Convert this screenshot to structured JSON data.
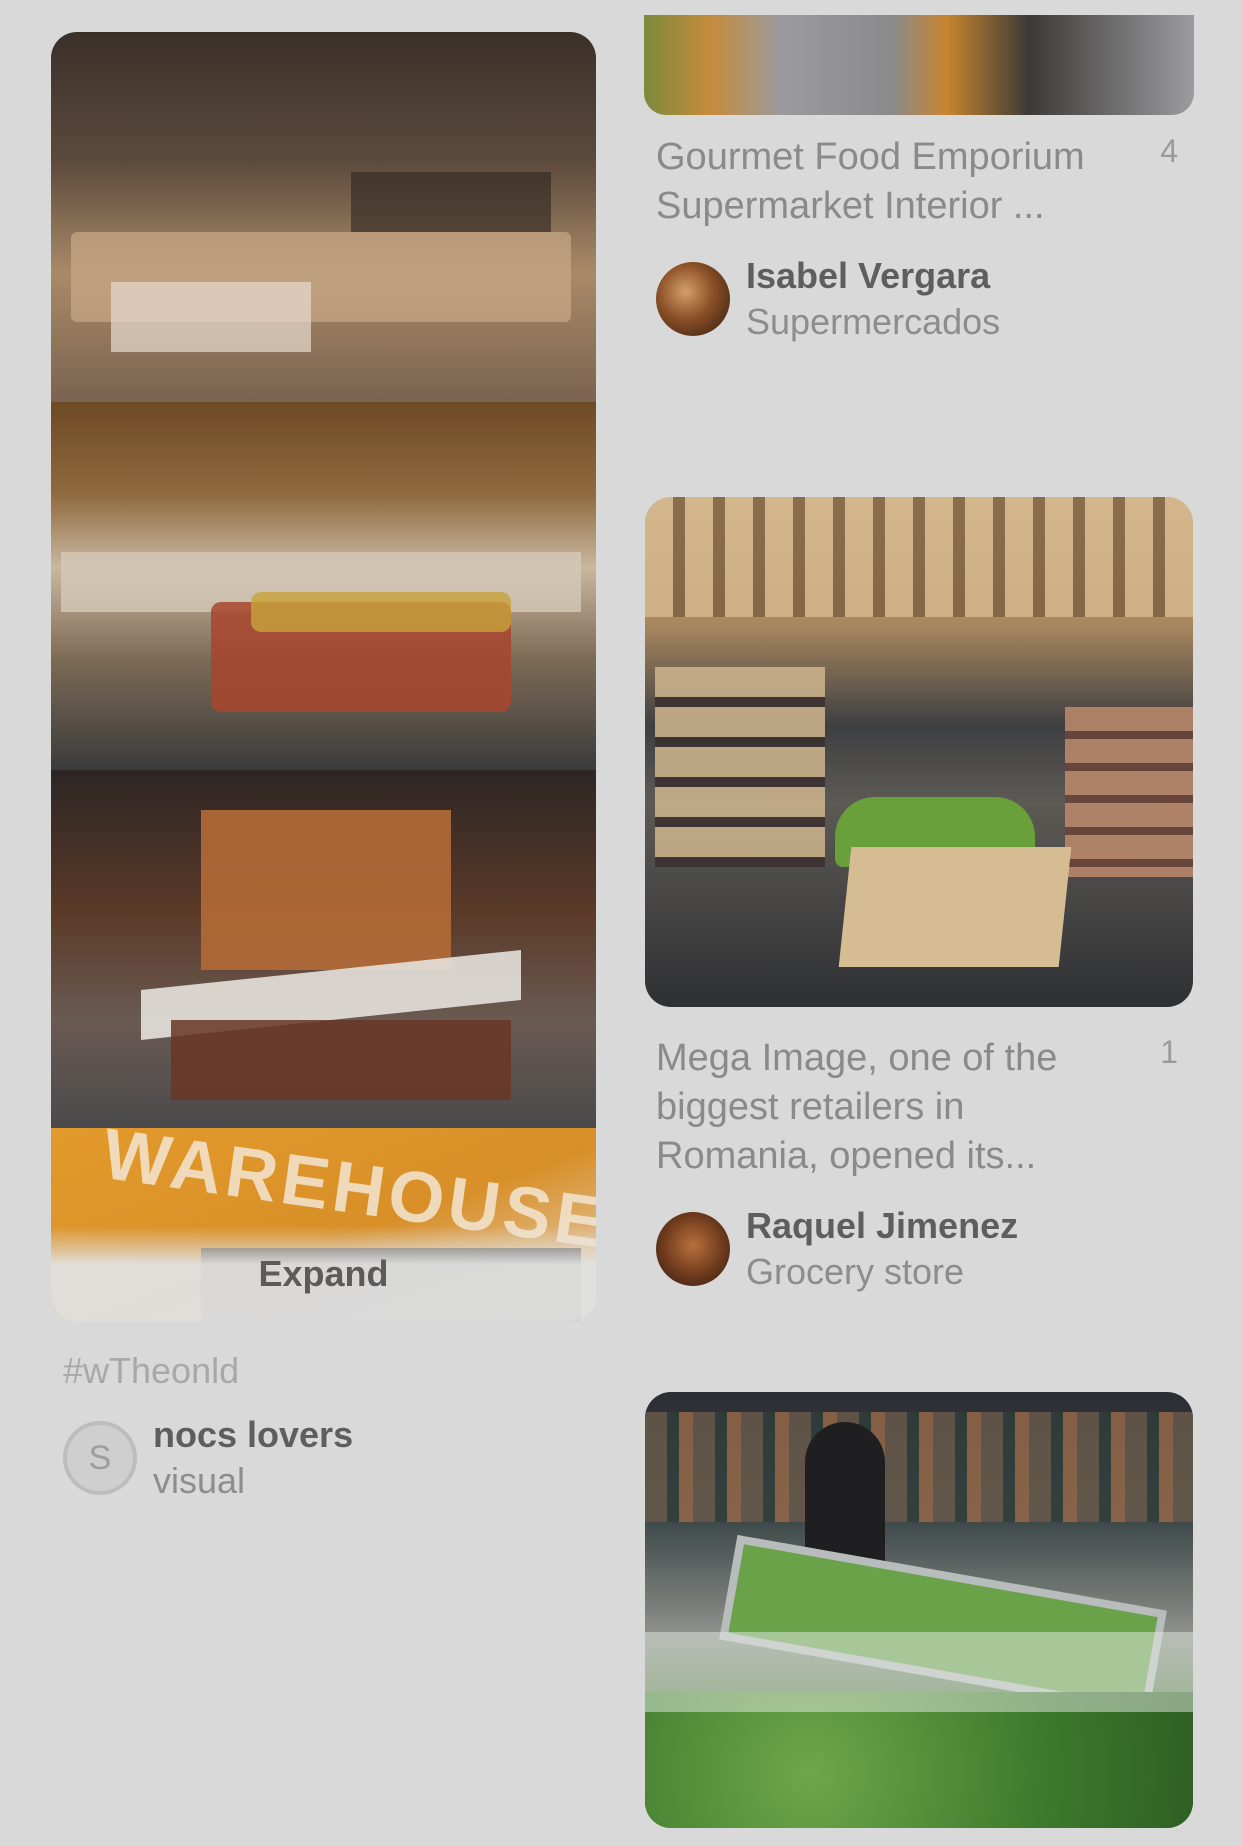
{
  "left_pin": {
    "expand_label": "Expand",
    "hashtag": "#wTheonld",
    "author_name": "nocs lovers",
    "author_board": "visual",
    "avatar_letter": "S"
  },
  "pins": [
    {
      "title": "Gourmet Food Emporium Supermarket Interior ...",
      "count": "4",
      "author_name": "Isabel Vergara",
      "author_board": "Supermercados"
    },
    {
      "title": "Mega Image, one of the biggest retailers in Romania, opened its...",
      "count": "1",
      "author_name": "Raquel Jimenez",
      "author_board": "Grocery store"
    }
  ],
  "sign_text": "WAREHOUSE"
}
